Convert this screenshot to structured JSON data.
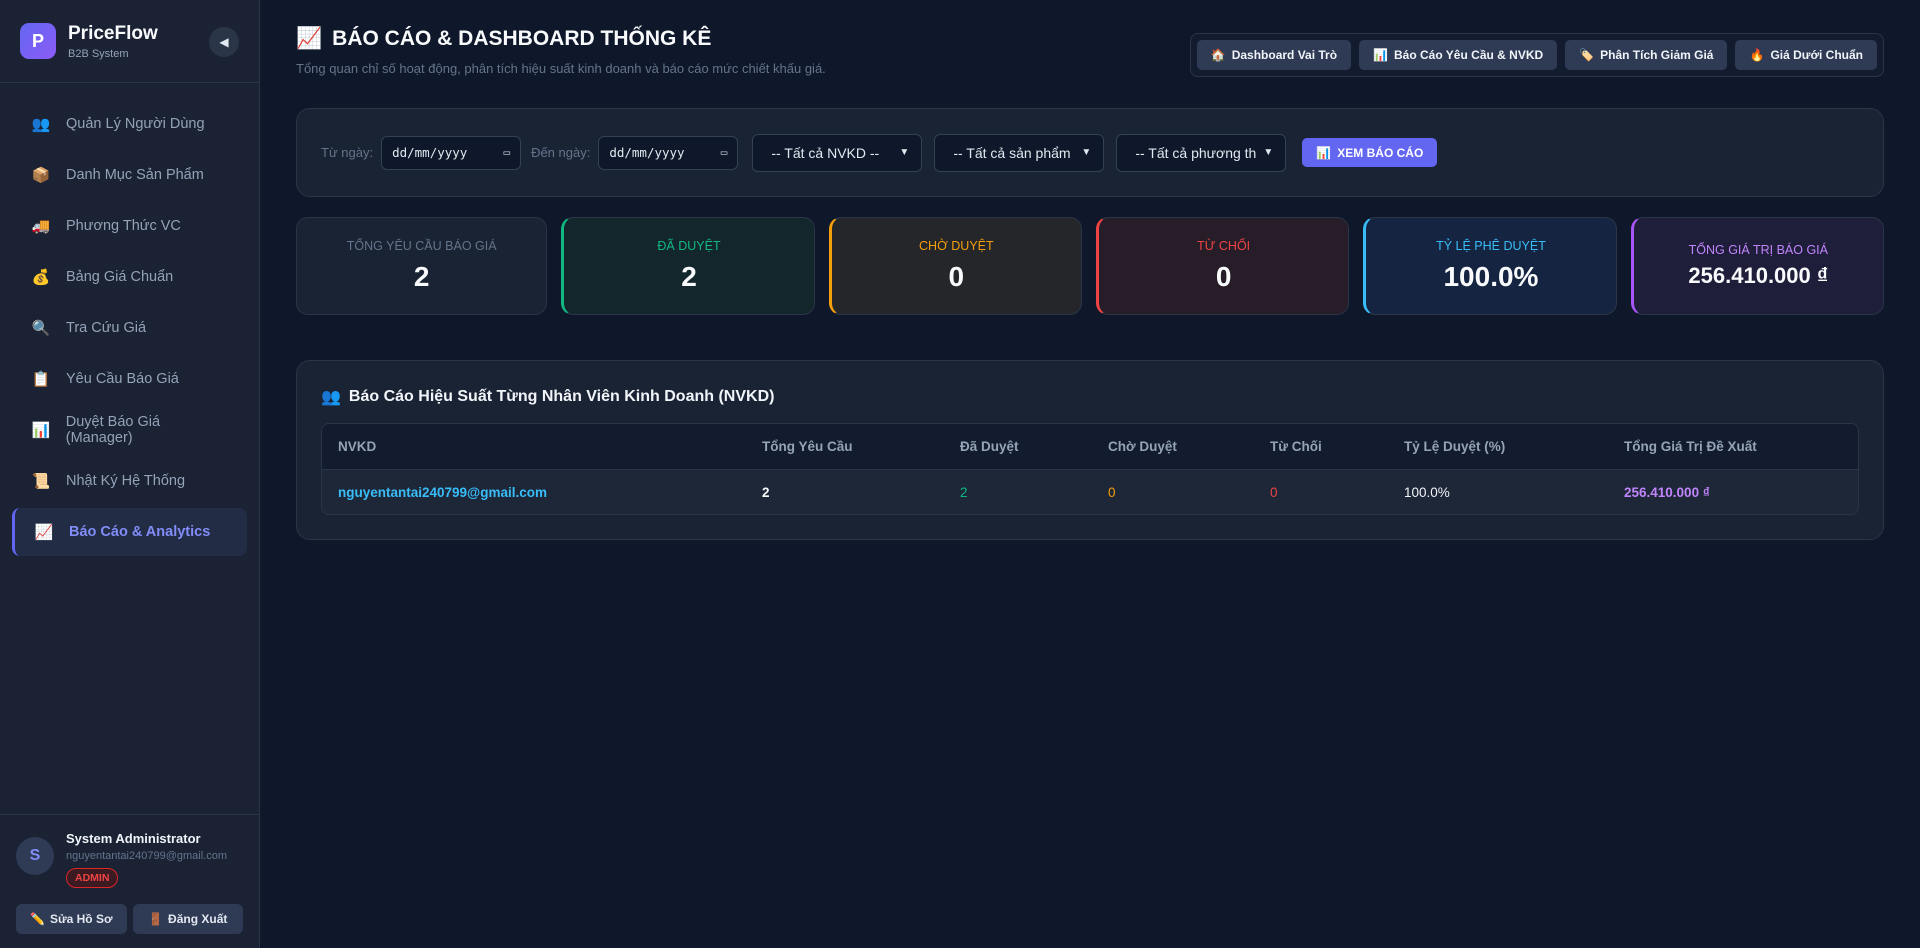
{
  "brand": {
    "logo_letter": "P",
    "name": "PriceFlow",
    "subtitle": "B2B System",
    "collapse_icon": "◀"
  },
  "sidebar": {
    "items": [
      {
        "icon": "👥",
        "label": "Quản Lý Người Dùng"
      },
      {
        "icon": "📦",
        "label": "Danh Mục Sản Phẩm"
      },
      {
        "icon": "🚚",
        "label": "Phương Thức VC"
      },
      {
        "icon": "💰",
        "label": "Bảng Giá Chuẩn"
      },
      {
        "icon": "🔍",
        "label": "Tra Cứu Giá"
      },
      {
        "icon": "📋",
        "label": "Yêu Cầu Báo Giá"
      },
      {
        "icon": "📊",
        "label": "Duyệt Báo Giá (Manager)"
      },
      {
        "icon": "📜",
        "label": "Nhật Ký Hệ Thống"
      },
      {
        "icon": "📈",
        "label": "Báo Cáo & Analytics"
      }
    ]
  },
  "user": {
    "avatar_letter": "S",
    "name": "System Administrator",
    "email": "nguyentantai240799@gmail.com",
    "role": "ADMIN",
    "edit_icon": "✏️",
    "edit_label": "Sửa Hồ Sơ",
    "logout_icon": "🚪",
    "logout_label": "Đăng Xuất"
  },
  "header": {
    "title_icon": "📈",
    "title": "BÁO CÁO & DASHBOARD THỐNG KÊ",
    "subtitle": "Tổng quan chỉ số hoạt động, phân tích hiệu suất kinh doanh và báo cáo mức chiết khấu giá.",
    "quick_nav": [
      {
        "icon": "🏠",
        "label": "Dashboard Vai Trò"
      },
      {
        "icon": "📊",
        "label": "Báo Cáo Yêu Cầu & NVKD"
      },
      {
        "icon": "🏷️",
        "label": "Phân Tích Giảm Giá"
      },
      {
        "icon": "🔥",
        "label": "Giá Dưới Chuẩn"
      }
    ]
  },
  "filters": {
    "from_label": "Từ ngày:",
    "from_value": "dd/mm/yyyy",
    "to_label": "Đến ngày:",
    "to_value": "dd/mm/yyyy",
    "staff_select": "-- Tất cả NVKD --",
    "product_select": "-- Tất cả sản phẩm",
    "method_select": "-- Tất cả phương th",
    "view_icon": "📊",
    "view_label": "XEM BÁO CÁO"
  },
  "stats": {
    "total_label": "Tổng yêu cầu báo giá",
    "total_value": "2",
    "approved_label": "Đã duyệt",
    "approved_value": "2",
    "pending_label": "Chờ duyệt",
    "pending_value": "0",
    "rejected_label": "Từ chối",
    "rejected_value": "0",
    "rate_label": "Tỷ lệ phê duyệt",
    "rate_value": "100.0%",
    "value_label": "Tổng giá trị báo giá",
    "value_value": "256.410.000 ₫"
  },
  "report": {
    "icon": "👥",
    "title": "Báo Cáo Hiệu Suất Từng Nhân Viên Kinh Doanh (NVKD)",
    "columns": [
      "NVKD",
      "Tổng Yêu Cầu",
      "Đã Duyệt",
      "Chờ Duyệt",
      "Từ Chối",
      "Tỷ Lệ Duyệt (%)",
      "Tổng Giá Trị Đề Xuất"
    ],
    "rows": [
      {
        "staff": "nguyentantai240799@gmail.com",
        "total": "2",
        "approved": "2",
        "pending": "0",
        "rejected": "0",
        "rate": "100.0%",
        "value": "256.410.000 ₫"
      }
    ]
  },
  "colors": {
    "accent": "#6366f1",
    "background": "#0f172a",
    "success": "#10b981",
    "warning": "#f59e0b",
    "danger": "#ef4444",
    "info": "#38bdf8",
    "purple": "#a855f7"
  }
}
